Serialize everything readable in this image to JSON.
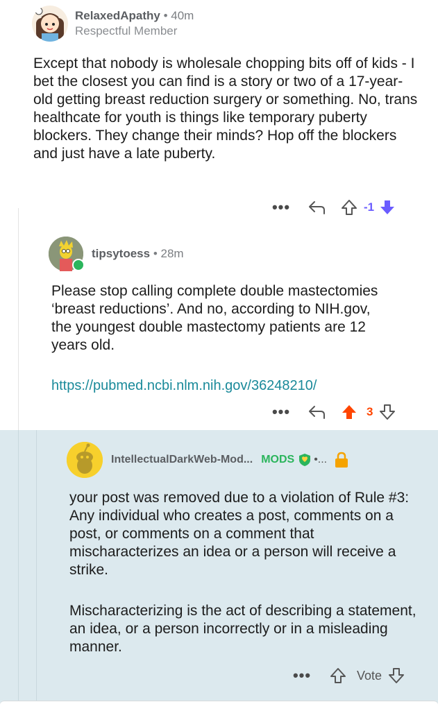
{
  "comments": [
    {
      "username": "RelaxedApathy",
      "time": "40m",
      "flair": "Respectful Member",
      "body": "Except that nobody is wholesale chopping bits off of kids - I bet the closest you can find is a story or two of a 17-year-old getting breast reduction surgery or something. No, trans healthcate for youth is things like temporary puberty blockers. They change their minds? Hop off the blockers and just have a late puberty.",
      "score": "-1"
    },
    {
      "username": "tipsytoess",
      "time": "28m",
      "body": "Please stop calling complete double mastectomies ‘breast reductions’. And no, according to NIH.gov, the youngest double mastectomy patients are 12 years old.",
      "link": "https://pubmed.ncbi.nlm.nih.gov/36248210/",
      "score": "3"
    },
    {
      "username": "IntellectualDarkWeb-Mod...",
      "mods_label": "MODS",
      "trailing": "•...",
      "body": "your post was removed due to a violation of Rule #3: Any individual who creates a post, comments on a post, or comments on a comment that mischaracterizes an idea or a person will receive a strike.",
      "body2": "Mischaracterizing is the act of describing a statement, an idea, or a person incorrectly or in a misleading manner.",
      "vote_label": "Vote"
    }
  ],
  "ui": {
    "more": "•••",
    "separator": "•"
  },
  "colors": {
    "downvote": "#6a5cff",
    "upvote": "#ff4500",
    "link": "#1a8a9a",
    "mod_green": "#2bb55c",
    "mod_highlight": "#dce9ee",
    "lock": "#f5a300"
  },
  "icons": [
    "reply-icon",
    "upvote-icon",
    "downvote-icon",
    "lock-icon",
    "mod-shield-icon",
    "more-icon"
  ]
}
